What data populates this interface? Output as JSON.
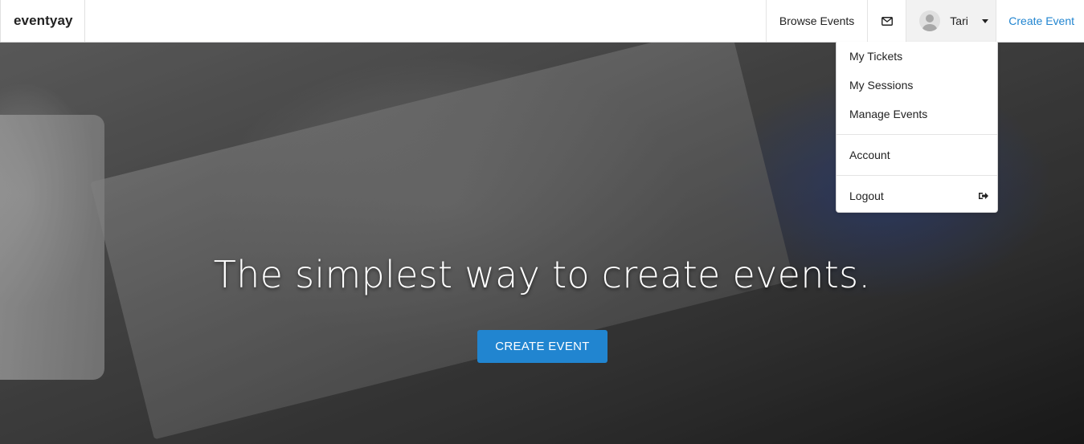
{
  "navbar": {
    "brand": "eventyay",
    "browse_events": "Browse Events",
    "mail_icon": "envelope-icon",
    "user_name": "Tari",
    "create_event": "Create Event"
  },
  "dropdown": {
    "items": [
      {
        "label": "My Tickets"
      },
      {
        "label": "My Sessions"
      },
      {
        "label": "Manage Events"
      },
      {
        "label": "Account"
      },
      {
        "label": "Logout",
        "icon": "sign-out-icon"
      }
    ]
  },
  "hero": {
    "title": "The simplest way to create events.",
    "cta": "CREATE EVENT"
  },
  "colors": {
    "accent": "#2185d0",
    "navbar_bg": "#ffffff",
    "user_item_bg": "#f2f2f2"
  }
}
